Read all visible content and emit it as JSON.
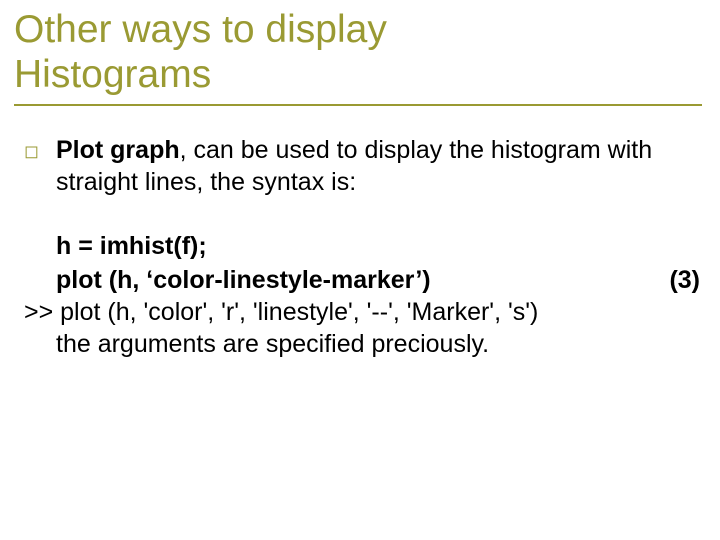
{
  "title_line1": "Other ways to display",
  "title_line2": " Histograms",
  "bullet_glyph": "◻",
  "bullet": {
    "bold": "Plot graph",
    "rest": ", can be used to display the histogram with straight lines, the syntax is:"
  },
  "code": {
    "line1": "h = imhist(f);",
    "line2": "plot (h, ‘color-linestyle-marker’)",
    "eqnum": "(3)"
  },
  "prompt_line": ">> plot (h, 'color', 'r', 'linestyle', '--', 'Marker', 's')",
  "last_line": "the arguments are specified preciously."
}
